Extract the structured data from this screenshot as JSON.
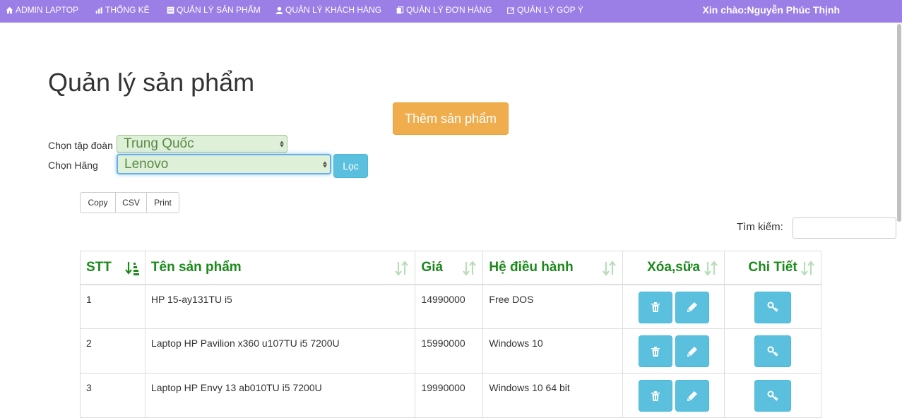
{
  "nav": {
    "items": [
      {
        "label": "ADMIN LAPTOP",
        "icon": "home-icon"
      },
      {
        "label": "THỐNG KÊ",
        "icon": "chart-icon"
      },
      {
        "label": "QUẢN LÝ SẢN PHẨM",
        "icon": "list-icon"
      },
      {
        "label": "QUẢN LÝ KHÁCH HÀNG",
        "icon": "user-icon"
      },
      {
        "label": "QUẢN LÝ ĐƠN HÀNG",
        "icon": "documents-icon"
      },
      {
        "label": "QUẢN LÝ GÓP Ý",
        "icon": "edit-icon"
      }
    ],
    "greeting": "Xin chào:Nguyễn Phúc Thịnh"
  },
  "page": {
    "title": "Quản lý sản phẩm",
    "add_button": "Thêm sản phẩm"
  },
  "filters": {
    "group_label": "Chọn tập đoàn",
    "group_value": "Trung Quốc",
    "brand_label": "Chọn Hãng",
    "brand_value": "Lenovo",
    "filter_button": "Lọc"
  },
  "export_buttons": [
    "Copy",
    "CSV",
    "Print"
  ],
  "search": {
    "label": "Tìm kiếm:",
    "value": ""
  },
  "table": {
    "columns": [
      "STT",
      "Tên sản phẩm",
      "Giá",
      "Hệ điều hành",
      "Xóa,sữa",
      "Chi Tiết"
    ],
    "rows": [
      {
        "stt": "1",
        "name": "HP 15-ay131TU i5",
        "price": "14990000",
        "os": "Free DOS"
      },
      {
        "stt": "2",
        "name": "Laptop HP Pavilion x360 u107TU i5 7200U",
        "price": "15990000",
        "os": "Windows 10"
      },
      {
        "stt": "3",
        "name": "Laptop HP Envy 13 ab010TU i5 7200U",
        "price": "19990000",
        "os": "Windows 10 64 bit"
      }
    ]
  },
  "colors": {
    "navbar": "#9b7fe6",
    "add_button": "#f0ad4e",
    "info_button": "#5bc0de",
    "header_text": "#1b8a1b",
    "select_bg": "#dff0d8"
  }
}
